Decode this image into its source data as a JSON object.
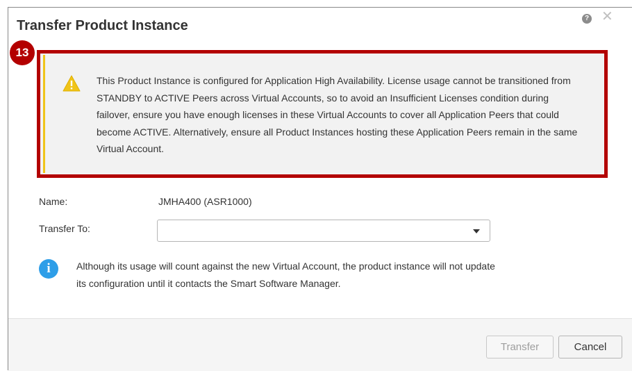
{
  "dialog": {
    "title": "Transfer Product Instance",
    "help_icon": "question-circle-icon",
    "help_glyph": "?",
    "close_icon": "close-icon",
    "close_glyph": "✕"
  },
  "callout": {
    "number": "13",
    "color": "#b30000"
  },
  "warning": {
    "icon": "warning-triangle-icon",
    "text": "This Product Instance is configured for Application High Availability. License usage cannot be transitioned from STANDBY to ACTIVE Peers across Virtual Accounts, so to avoid an Insufficient Licenses condition during failover, ensure you have enough licenses in these Virtual Accounts to cover all Application Peers that could become ACTIVE. Alternatively, ensure all Product Instances hosting these Application Peers remain in the same Virtual Account."
  },
  "form": {
    "name_label": "Name:",
    "name_value": "JMHA400 (ASR1000)",
    "transfer_to_label": "Transfer To:",
    "transfer_to_value": ""
  },
  "info": {
    "icon": "info-circle-icon",
    "glyph": "i",
    "text": "Although its usage will count against the new Virtual Account, the product instance will not update its configuration until it contacts the Smart Software Manager."
  },
  "footer": {
    "transfer_label": "Transfer",
    "cancel_label": "Cancel"
  },
  "colors": {
    "warning_yellow": "#f0c419",
    "info_blue": "#2e9ee8"
  }
}
